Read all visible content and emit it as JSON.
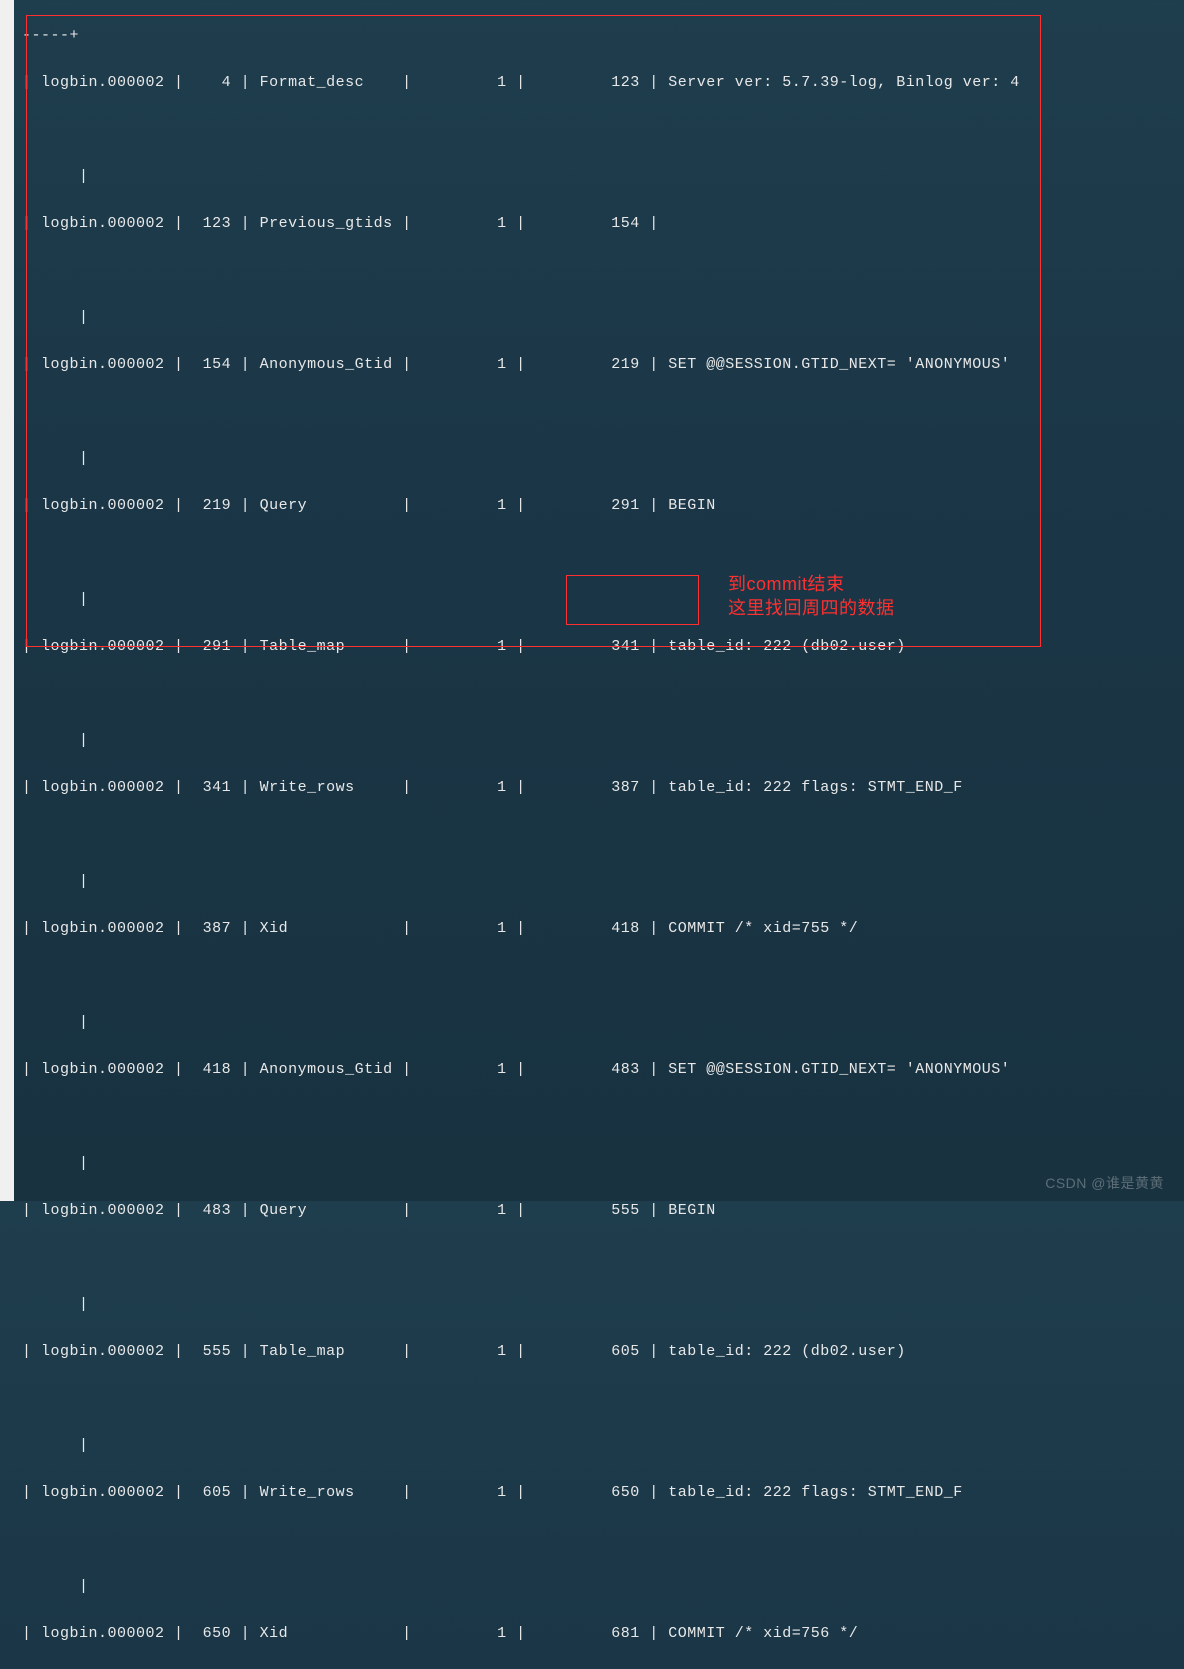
{
  "header": "-----+",
  "rows": [
    {
      "log": "logbin.000002",
      "pos": "4",
      "event": "Format_desc",
      "srv": "1",
      "end": "123",
      "info": "Server ver: 5.7.39-log, Binlog ver: 4"
    },
    {
      "log": "logbin.000002",
      "pos": "123",
      "event": "Previous_gtids",
      "srv": "1",
      "end": "154",
      "info": ""
    },
    {
      "log": "logbin.000002",
      "pos": "154",
      "event": "Anonymous_Gtid",
      "srv": "1",
      "end": "219",
      "info": "SET @@SESSION.GTID_NEXT= 'ANONYMOUS'"
    },
    {
      "log": "logbin.000002",
      "pos": "219",
      "event": "Query",
      "srv": "1",
      "end": "291",
      "info": "BEGIN"
    },
    {
      "log": "logbin.000002",
      "pos": "291",
      "event": "Table_map",
      "srv": "1",
      "end": "341",
      "info": "table_id: 222 (db02.user)"
    },
    {
      "log": "logbin.000002",
      "pos": "341",
      "event": "Write_rows",
      "srv": "1",
      "end": "387",
      "info": "table_id: 222 flags: STMT_END_F"
    },
    {
      "log": "logbin.000002",
      "pos": "387",
      "event": "Xid",
      "srv": "1",
      "end": "418",
      "info": "COMMIT /* xid=755 */"
    },
    {
      "log": "logbin.000002",
      "pos": "418",
      "event": "Anonymous_Gtid",
      "srv": "1",
      "end": "483",
      "info": "SET @@SESSION.GTID_NEXT= 'ANONYMOUS'"
    },
    {
      "log": "logbin.000002",
      "pos": "483",
      "event": "Query",
      "srv": "1",
      "end": "555",
      "info": "BEGIN"
    },
    {
      "log": "logbin.000002",
      "pos": "555",
      "event": "Table_map",
      "srv": "1",
      "end": "605",
      "info": "table_id: 222 (db02.user)"
    },
    {
      "log": "logbin.000002",
      "pos": "605",
      "event": "Write_rows",
      "srv": "1",
      "end": "650",
      "info": "table_id: 222 flags: STMT_END_F"
    },
    {
      "log": "logbin.000002",
      "pos": "650",
      "event": "Xid",
      "srv": "1",
      "end": "681",
      "info": "COMMIT /* xid=756 */"
    }
  ],
  "annotation": {
    "line1": "到commit结束",
    "line2": "这里找回周四的数据"
  },
  "watermark": "CSDN @谁是黄黄"
}
